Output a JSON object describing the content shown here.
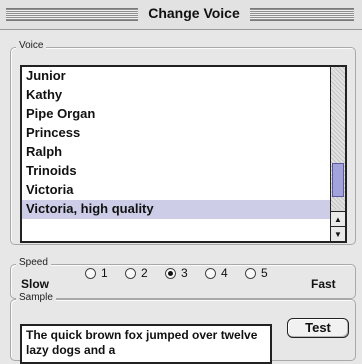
{
  "window": {
    "title": "Change Voice"
  },
  "voice": {
    "group_label": "Voice",
    "items": [
      {
        "label": "Junior",
        "selected": false
      },
      {
        "label": "Kathy",
        "selected": false
      },
      {
        "label": "Pipe Organ",
        "selected": false
      },
      {
        "label": "Princess",
        "selected": false
      },
      {
        "label": "Ralph",
        "selected": false
      },
      {
        "label": "Trinoids",
        "selected": false
      },
      {
        "label": "Victoria",
        "selected": false
      },
      {
        "label": "Victoria, high quality",
        "selected": true
      }
    ],
    "scroll_position": 0.9
  },
  "speed": {
    "group_label": "Speed",
    "slow_label": "Slow",
    "fast_label": "Fast",
    "options": [
      "1",
      "2",
      "3",
      "4",
      "5"
    ],
    "selected": "3"
  },
  "sample": {
    "group_label": "Sample",
    "text": "The quick brown fox jumped over twelve lazy dogs and a",
    "test_label": "Test"
  },
  "colors": {
    "selection": "#cdcde8",
    "scroll_thumb": "#a3a3dc"
  }
}
